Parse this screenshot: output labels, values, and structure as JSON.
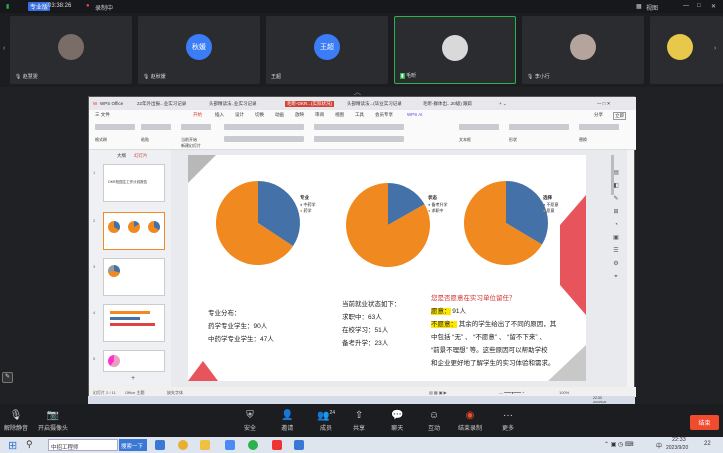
{
  "topbar": {
    "badge": "专业版",
    "time": "03:38:26",
    "recording": "录制中",
    "view": "视图"
  },
  "participants": [
    {
      "name": "赵慧雯",
      "avatar": ""
    },
    {
      "name": "赵秋媛",
      "avatar": "秋媛"
    },
    {
      "name": "王超",
      "avatar": "王超"
    },
    {
      "name": "毛昕",
      "avatar": ""
    },
    {
      "name": "李小行",
      "avatar": ""
    }
  ],
  "wps": {
    "tabs": [
      "WPS Office",
      "22年外出报...业实习记录",
      "头部精读法..业实习记录",
      "毛昕-OKR...(实际状况)",
      "头部精读法...(毕业实习记录",
      "毛昕-群体出...20级) 跟踪"
    ],
    "menu": [
      "三 文件",
      "开始",
      "插入",
      "设计",
      "切换",
      "动画",
      "放映",
      "审阅",
      "视图",
      "工具",
      "会员专享",
      "WPS AI"
    ],
    "menu_right": [
      "分享",
      "立即"
    ],
    "ribbon": [
      "格式刷",
      "粘贴",
      "当前开始",
      "新建幻灯片",
      "版式",
      "节",
      "文本框",
      "形状",
      "排列",
      "替换",
      "选择"
    ],
    "panel_tabs": [
      "大纲",
      "幻灯片"
    ],
    "thumb_title": "OKR校园生工作计划报告",
    "add": "+",
    "status": [
      "幻灯片 2 / 11",
      "Office 主题",
      "缺失字体"
    ],
    "zoom": "100%"
  },
  "slide": {
    "legends": [
      {
        "title": "专业",
        "items": [
          "中药学",
          "药学"
        ]
      },
      {
        "title": "状态",
        "items": [
          "备考升学",
          "求职中"
        ]
      },
      {
        "title": "选择",
        "items": [
          "不愿意",
          "愿意"
        ]
      }
    ],
    "left_text": [
      "专业分布：",
      "药学专业学生：90人",
      "中药学专业学生：47人"
    ],
    "mid_text": [
      "当前就业状态如下：",
      "求职中：63人",
      "在校学习：51人",
      "备考升学：23人"
    ],
    "right_title": "您是否愿意在实习单位留任？",
    "right_willing": "愿意：",
    "right_willing_val": " 91人",
    "right_unwilling": "不愿意：",
    "right_line1": " 其余的学生给出了不同的原因，其",
    "right_line2": "中包括 “无” 、 “不愿意” 、 “留不下来” 、",
    "right_line3": "“前景不理想” 等。这些原因可以帮助学校",
    "right_line4": "和企业更好地了解学生的实习体验和需求。",
    "colors": {
      "orange": "#f0891f",
      "blue": "#4472a8"
    }
  },
  "chart_data": [
    {
      "type": "pie",
      "title": "专业",
      "categories": [
        "中药学",
        "药学"
      ],
      "values": [
        47,
        90
      ]
    },
    {
      "type": "pie",
      "title": "状态",
      "categories": [
        "备考升学",
        "求职中"
      ],
      "values": [
        23,
        114
      ]
    },
    {
      "type": "pie",
      "title": "选择",
      "categories": [
        "不愿意",
        "愿意"
      ],
      "values": [
        46,
        91
      ]
    }
  ],
  "controls": {
    "left": [
      {
        "label": "解除静音"
      },
      {
        "label": "开启摄像头"
      }
    ],
    "center": [
      {
        "label": "安全",
        "icon": "shield-icon"
      },
      {
        "label": "邀请",
        "icon": "invite-icon"
      },
      {
        "label": "成员",
        "icon": "members-icon",
        "badge": "24"
      },
      {
        "label": "共享",
        "icon": "share-icon"
      },
      {
        "label": "聊天",
        "icon": "chat-icon"
      },
      {
        "label": "互动",
        "icon": "emoji-icon"
      },
      {
        "label": "结束录制",
        "icon": "record-icon"
      },
      {
        "label": "更多",
        "icon": "more-icon"
      }
    ],
    "end": "结束"
  },
  "taskbar": {
    "search": "中招工程师",
    "search_btn": "搜索一下",
    "time": "22:33",
    "date": "2023/9/20",
    "tray": "中",
    "notif": "22"
  },
  "inner_taskbar": {
    "time": "22:33",
    "date": "2023/9/20"
  }
}
